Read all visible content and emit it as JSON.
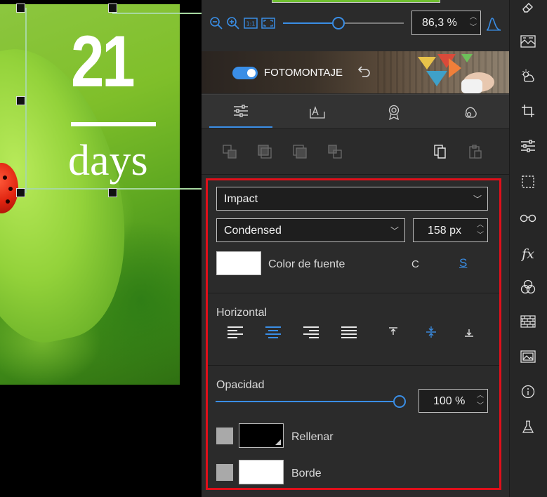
{
  "canvas": {
    "headline_number": "21",
    "headline_word": "days"
  },
  "zoom": {
    "value": "86,3 %",
    "level_percent": 86.3,
    "slider_fraction": 0.46
  },
  "banner": {
    "label": "FOTOMONTAJE",
    "toggle_on": true
  },
  "tabs": [
    {
      "name": "adjust",
      "icon": "sliders-icon",
      "active": true
    },
    {
      "name": "text",
      "icon": "text-frame-icon",
      "active": false
    },
    {
      "name": "effects",
      "icon": "award-icon",
      "active": false
    },
    {
      "name": "shapes",
      "icon": "shapes-icon",
      "active": false
    }
  ],
  "layer_tools": [
    "layer-back-icon",
    "layer-backward-icon",
    "layer-forward-icon",
    "layer-front-icon",
    "copy-icon",
    "paste-icon"
  ],
  "font": {
    "family": "Impact",
    "style": "Condensed",
    "size": "158 px",
    "color_label": "Color de fuente",
    "color": "#ffffff",
    "caps_option": "C",
    "strike_option": "S"
  },
  "alignment": {
    "heading": "Horizontal",
    "horizontal_options": [
      "align-left-icon",
      "align-center-icon",
      "align-right-icon",
      "align-justify-icon"
    ],
    "horizontal_active": 1,
    "vertical_options": [
      "align-top-icon",
      "align-middle-icon",
      "align-bottom-icon"
    ],
    "vertical_active": 1
  },
  "opacity": {
    "heading": "Opacidad",
    "value": "100 %",
    "level_percent": 100
  },
  "fill": {
    "label": "Rellenar",
    "color": "#000000",
    "enabled": false
  },
  "border": {
    "label": "Borde",
    "color": "#ffffff",
    "enabled": false
  },
  "colors": {
    "accent": "#3a8ee6",
    "highlight_frame": "#e00f1a",
    "panel_bg": "#2b2b2b"
  },
  "toolbar": [
    "eraser-icon",
    "texture-icon",
    "weather-icon",
    "crop-icon",
    "sliders-icon",
    "selection-icon",
    "glasses-icon",
    "fx-icon",
    "color-circles-icon",
    "brick-wall-icon",
    "image-icon",
    "info-icon",
    "flask-icon"
  ]
}
